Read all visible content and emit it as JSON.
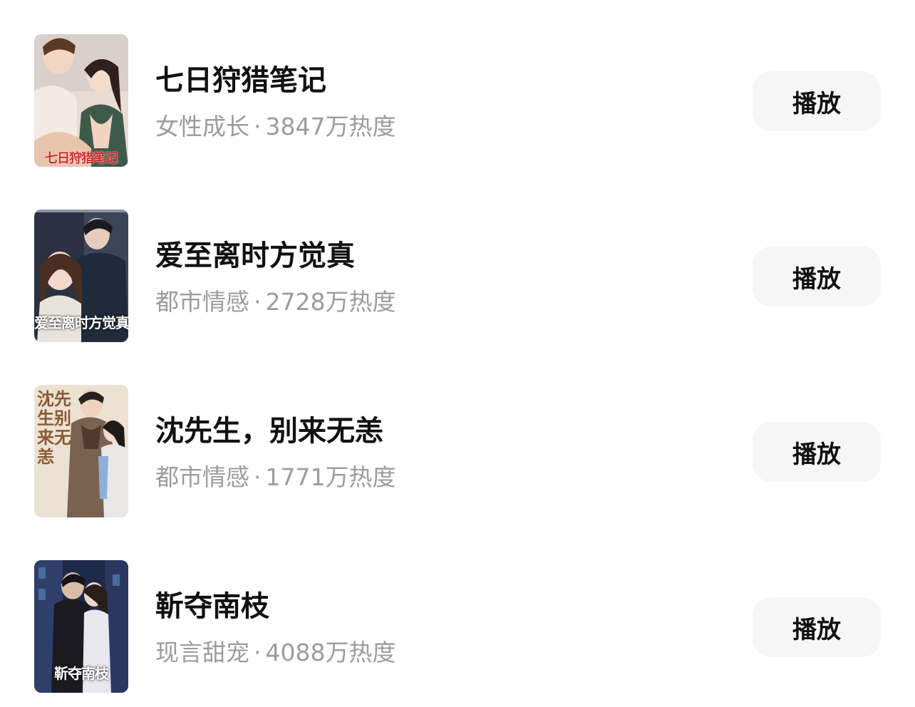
{
  "dramas": [
    {
      "title": "七日狩猎笔记",
      "genre": "女性成长",
      "separator": "·",
      "heat": "3847万热度",
      "play_label": "播放",
      "poster_text": "七日狩猎笔记"
    },
    {
      "title": "爱至离时方觉真",
      "genre": "都市情感",
      "separator": "·",
      "heat": "2728万热度",
      "play_label": "播放",
      "poster_text": "爱至离时方觉真"
    },
    {
      "title": "沈先生，别来无恙",
      "genre": "都市情感",
      "separator": "·",
      "heat": "1771万热度",
      "play_label": "播放",
      "poster_text": "沈先生别来无恙"
    },
    {
      "title": "靳夺南枝",
      "genre": "现言甜宠",
      "separator": "·",
      "heat": "4088万热度",
      "play_label": "播放",
      "poster_text": "靳夺南枝"
    }
  ]
}
